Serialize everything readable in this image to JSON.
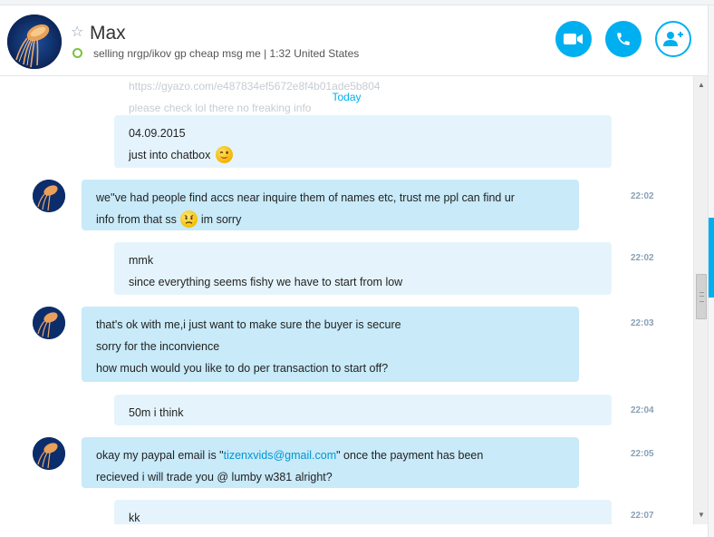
{
  "contact": {
    "name": "Max",
    "mood": "selling nrgp/ikov gp cheap msg me | 1:32 United States",
    "presence_color": "#7bc142"
  },
  "header": {
    "video_call_icon": "video-camera-icon",
    "voice_call_icon": "phone-icon",
    "add_contact_icon": "add-person-icon",
    "accent": "#00aff0"
  },
  "chat": {
    "faded_lines": [
      "https://gyazo.com/e487834ef5672e8f4b01ade5b804",
      "please check lol there no freaking info"
    ],
    "date_divider": "Today",
    "messages": [
      {
        "from": "me",
        "lines": [
          "04.09.2015",
          "just into chatbox"
        ],
        "emoji": "wink",
        "time": ""
      },
      {
        "from": "them",
        "lines": [
          "we''ve had people find accs near inquire them of names etc, trust me ppl can find ur",
          "info from that ss",
          "im sorry"
        ],
        "emoji": "worried",
        "time": "22:02"
      },
      {
        "from": "me",
        "lines": [
          "mmk",
          "since everything seems fishy we have to start from low"
        ],
        "time": "22:02"
      },
      {
        "from": "them",
        "lines": [
          "that's ok with me,i just want to make sure the buyer is secure",
          "sorry for the inconvience",
          "how much would you like to do per transaction to start off?"
        ],
        "time": "22:03"
      },
      {
        "from": "me",
        "lines": [
          "50m i think"
        ],
        "time": "22:04"
      },
      {
        "from": "them",
        "lines": [
          "okay my paypal email is \"",
          "tizenxvids@gmail.com",
          "\" once the payment has been",
          "recieved i will trade you @ lumby w381 alright?"
        ],
        "time": "22:05"
      },
      {
        "from": "me",
        "lines": [
          "kk"
        ],
        "time": "22:07"
      }
    ]
  }
}
